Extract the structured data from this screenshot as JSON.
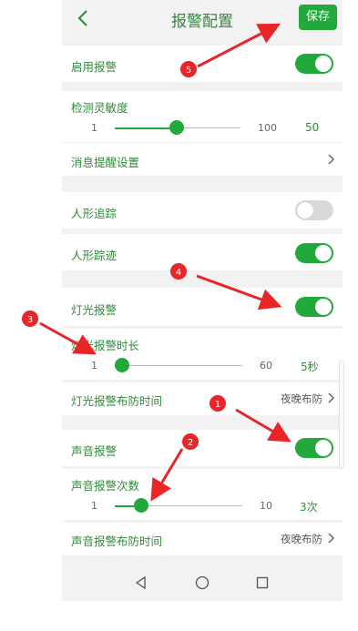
{
  "header": {
    "title": "报警配置",
    "save_label": "保存"
  },
  "rows": {
    "enable_alarm": {
      "label": "启用报警",
      "on": true
    },
    "sensitivity": {
      "label": "检测灵敏度",
      "min": "1",
      "max": "100",
      "value": "50",
      "fraction": 0.495
    },
    "message_settings": {
      "label": "消息提醒设置"
    },
    "human_tracking": {
      "label": "人形追踪",
      "on": false
    },
    "human_trace": {
      "label": "人形踪迹",
      "on": true
    },
    "light_alarm": {
      "label": "灯光报警",
      "on": true
    },
    "light_duration": {
      "label": "灯光报警时长",
      "min": "1",
      "max": "60",
      "value": "5秒",
      "fraction": 0.068
    },
    "light_schedule": {
      "label": "灯光报警布防时间",
      "value": "夜晚布防"
    },
    "sound_alarm": {
      "label": "声音报警",
      "on": true
    },
    "sound_count": {
      "label": "声音报警次数",
      "min": "1",
      "max": "10",
      "value": "3次",
      "fraction": 0.222
    },
    "sound_schedule": {
      "label": "声音报警布防时间",
      "value": "夜晚布防"
    }
  },
  "annotations": [
    "1",
    "2",
    "3",
    "4",
    "5"
  ],
  "colors": {
    "accent": "#22a93b",
    "text_green": "#2f8a3a",
    "annotation_red": "#e8262a",
    "background": "#f2f2f2"
  }
}
